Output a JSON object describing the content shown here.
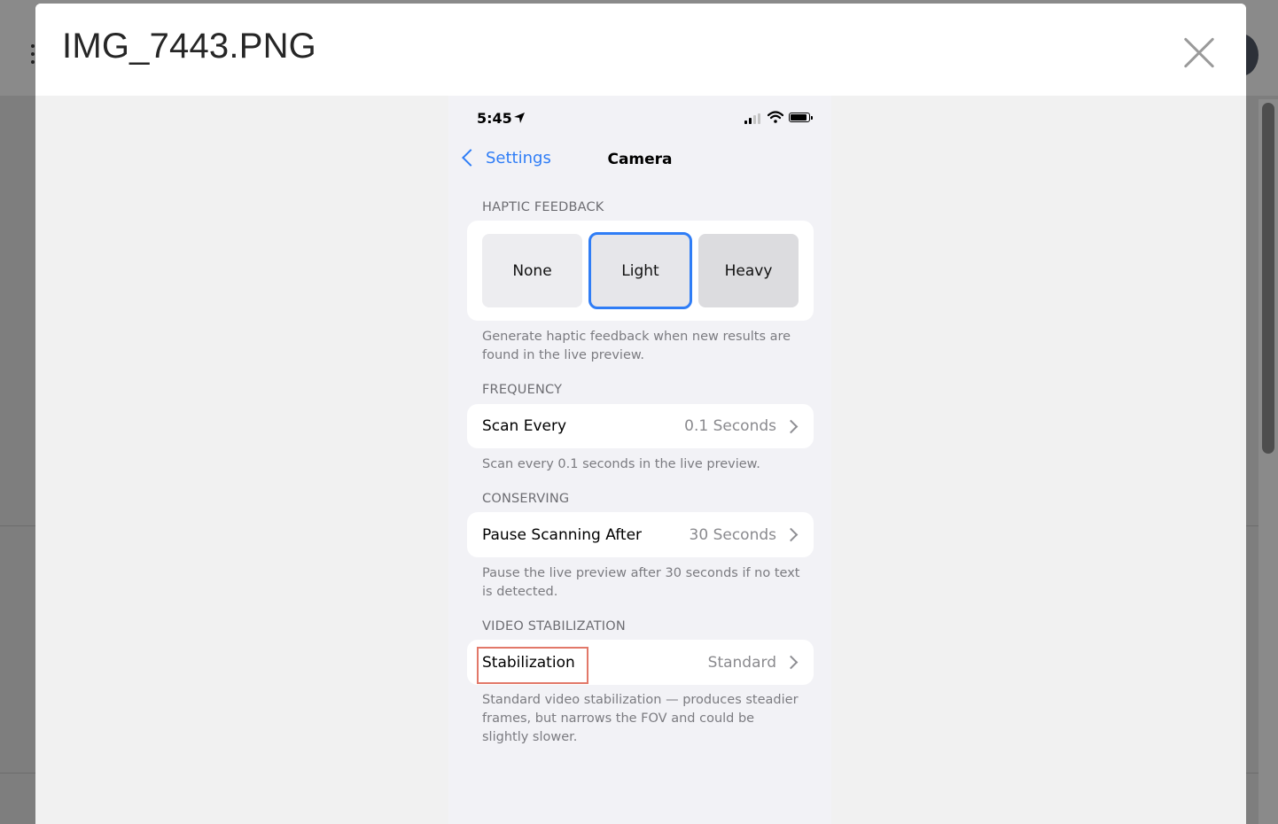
{
  "modal": {
    "title": "IMG_7443.PNG",
    "close_icon": "close-icon"
  },
  "phone": {
    "status_bar": {
      "time": "5:45",
      "icons": [
        "location-arrow-icon",
        "cellular-signal-icon",
        "wifi-icon",
        "battery-icon"
      ]
    },
    "nav": {
      "back_label": "Settings",
      "title": "Camera"
    },
    "sections": {
      "haptic": {
        "header": "HAPTIC FEEDBACK",
        "options": [
          "None",
          "Light",
          "Heavy"
        ],
        "selected": "Light",
        "footer": "Generate haptic feedback when new results are found in the live preview."
      },
      "frequency": {
        "header": "FREQUENCY",
        "row_label": "Scan Every",
        "row_value": "0.1 Seconds",
        "footer": "Scan every 0.1 seconds in the live preview."
      },
      "conserving": {
        "header": "CONSERVING",
        "row_label": "Pause Scanning After",
        "row_value": "30 Seconds",
        "footer": "Pause the live preview after 30 seconds if no text is detected."
      },
      "stabilization": {
        "header": "VIDEO STABILIZATION",
        "row_label": "Stabilization",
        "row_value": "Standard",
        "footer": "Standard video stabilization — produces steadier frames, but narrows the FOV and could be slightly slower."
      }
    }
  },
  "colors": {
    "accent_blue": "#2f7df6",
    "highlight_box": "#e27869",
    "ios_background": "#f2f2f6"
  }
}
